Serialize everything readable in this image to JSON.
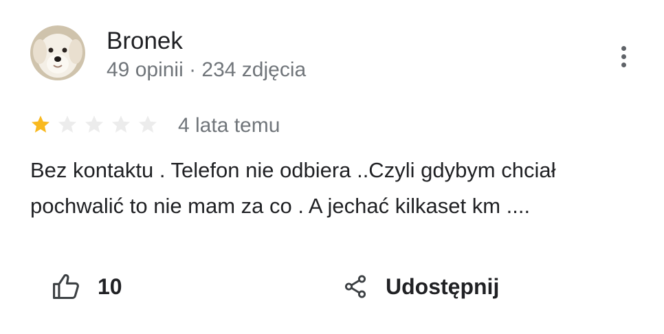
{
  "review": {
    "author_name": "Bronek",
    "author_meta": "49 opinii · 234 zdjęcia",
    "rating": 1,
    "rating_max": 5,
    "time_ago": "4 lata temu",
    "text_lines": [
      "Bez kontaktu . Telefon nie odbiera ..Czyli gdybym chciał",
      "pochwalić to nie mam za co . A jechać kilkaset km ...."
    ],
    "likes": "10",
    "share_label": "Udostępnij"
  },
  "icons": {
    "avatar": "dog-avatar",
    "more": "more-vert-icon",
    "like": "thumb-up-icon",
    "share": "share-icon",
    "star": "star-icon"
  },
  "colors": {
    "star_filled": "#f9b91f",
    "star_empty": "#ececec",
    "text_primary": "#202124",
    "text_secondary": "#70757a"
  }
}
